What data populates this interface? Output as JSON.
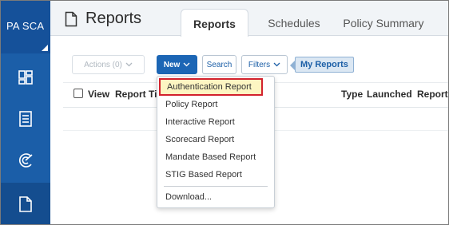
{
  "app": {
    "brand": "PA SCA"
  },
  "header": {
    "title": "Reports",
    "tabs": [
      {
        "label": "Reports",
        "active": true
      },
      {
        "label": "Schedules",
        "active": false
      },
      {
        "label": "Policy Summary",
        "active": false
      }
    ]
  },
  "toolbar": {
    "actions_label": "Actions (0)",
    "new_label": "New",
    "search_label": "Search",
    "filters_label": "Filters",
    "filter_tag": "My Reports"
  },
  "table": {
    "columns": [
      "View",
      "Report Ti",
      "Type",
      "Launched",
      "Report"
    ]
  },
  "new_menu": {
    "items": [
      "Authentication Report",
      "Policy Report",
      "Interactive Report",
      "Scorecard Report",
      "Mandate Based Report",
      "STIG Based Report"
    ],
    "download_label": "Download..."
  },
  "colors": {
    "nav": "#1b5ea8",
    "primary": "#1c66b5",
    "highlight_fill": "#fdf6c2",
    "highlight_border": "#d2222d"
  },
  "icons": {
    "nav": [
      "dashboard-icon",
      "document-list-icon",
      "scan-icon",
      "report-icon"
    ]
  }
}
